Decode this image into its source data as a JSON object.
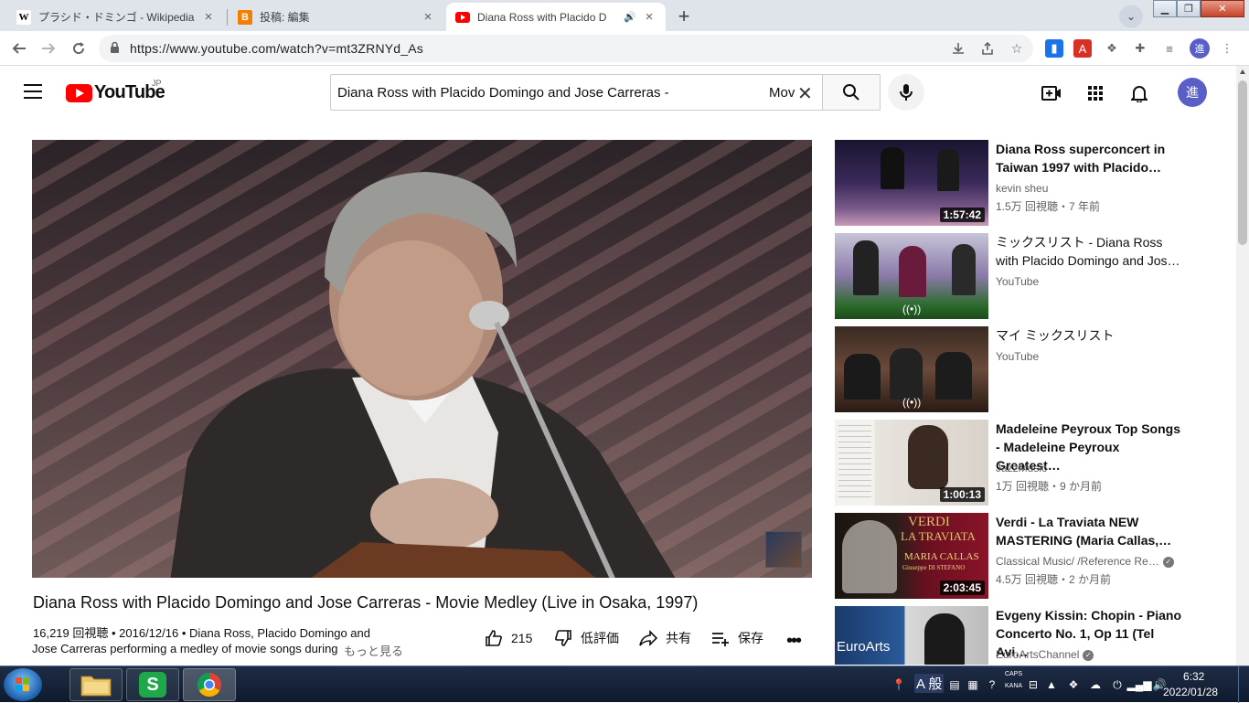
{
  "browser": {
    "tabs": [
      {
        "title": "プラシド・ドミンゴ - Wikipedia",
        "favicon": "wikipedia-icon"
      },
      {
        "title": "投稿: 編集",
        "favicon": "blogger-icon"
      },
      {
        "title": "Diana Ross with Placido D",
        "favicon": "youtube-icon"
      }
    ],
    "url": "https://www.youtube.com/watch?v=mt3ZRNYd_As",
    "profile_initial": "進"
  },
  "youtube": {
    "logo_text": "YouTube",
    "country_code": "JP",
    "search_query": "Diana Ross with Placido Domingo and Jose Carreras -",
    "search_query_overflow": "Mov",
    "avatar_initial": "進"
  },
  "video": {
    "title": "Diana Ross with Placido Domingo and Jose Carreras - Movie Medley (Live in Osaka, 1997)",
    "meta_line1": "16,219 回視聴 • 2016/12/16 • Diana Ross, Placido Domingo and",
    "meta_line2": "Jose Carreras performing a medley of movie songs during",
    "more_label": "もっと見る",
    "actions": {
      "like_count": "215",
      "dislike_label": "低評価",
      "share_label": "共有",
      "save_label": "保存"
    }
  },
  "recommendations": [
    {
      "title": "Diana Ross superconcert in Taiwan 1997 with Placido…",
      "channel": "kevin sheu",
      "stats": "1.5万 回視聴・7 年前",
      "duration": "1:57:42",
      "verified": false
    },
    {
      "title": "ミックスリスト - Diana Ross with Placido Domingo and Jos…",
      "channel": "YouTube",
      "stats": "",
      "duration": "",
      "mix": true,
      "verified": false
    },
    {
      "title": "マイ ミックスリスト",
      "channel": "YouTube",
      "stats": "",
      "duration": "",
      "mix": true,
      "verified": false
    },
    {
      "title": "Madeleine Peyroux Top Songs - Madeleine Peyroux Greatest…",
      "channel": "JazzMusic",
      "stats": "1万 回視聴・9 か月前",
      "duration": "1:00:13",
      "verified": false
    },
    {
      "title": "Verdi - La Traviata NEW MASTERING (Maria Callas,…",
      "channel": "Classical Music/ /Reference Re…",
      "stats": "4.5万 回視聴・2 か月前",
      "duration": "2:03:45",
      "verified": true
    },
    {
      "title": "Evgeny Kissin: Chopin - Piano Concerto No. 1, Op 11 (Tel Avi…",
      "channel": "EuroArtsChannel",
      "stats": "",
      "duration": "",
      "verified": true
    }
  ],
  "thumb_text": {
    "verdi": "VERDI",
    "traviata": "LA TRAVIATA",
    "callas": "MARIA CALLAS",
    "cast": "Giuseppe DI STEFANO",
    "euroarts": "EuroArts"
  },
  "taskbar": {
    "ime_label": "A 般",
    "caps": "CAPS",
    "kana": "KANA",
    "time": "6:32",
    "date": "2022/01/28"
  },
  "colors": {
    "youtube_red": "#ff0000",
    "accent_blue": "#065fd4",
    "taskbar": "#142238"
  }
}
